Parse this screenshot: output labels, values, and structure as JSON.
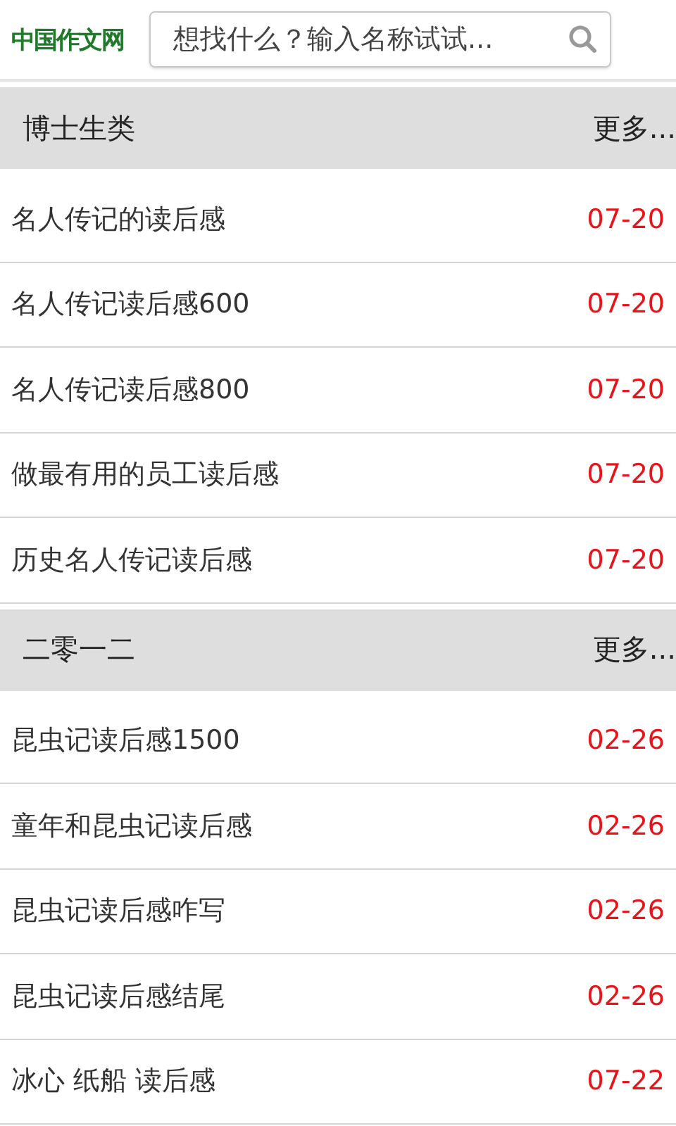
{
  "header": {
    "logo": "中国作文网",
    "search": {
      "placeholder": "想找什么？输入名称试试..."
    }
  },
  "sections": [
    {
      "title": "博士生类",
      "more": "更多...",
      "items": [
        {
          "title": "名人传记的读后感",
          "date": "07-20"
        },
        {
          "title": "名人传记读后感600",
          "date": "07-20"
        },
        {
          "title": "名人传记读后感800",
          "date": "07-20"
        },
        {
          "title": "做最有用的员工读后感",
          "date": "07-20"
        },
        {
          "title": "历史名人传记读后感",
          "date": "07-20"
        }
      ]
    },
    {
      "title": "二零一二",
      "more": "更多...",
      "items": [
        {
          "title": "昆虫记读后感1500",
          "date": "02-26"
        },
        {
          "title": "童年和昆虫记读后感",
          "date": "02-26"
        },
        {
          "title": "昆虫记读后感咋写",
          "date": "02-26"
        },
        {
          "title": "昆虫记读后感结尾",
          "date": "02-26"
        },
        {
          "title": "冰心 纸船 读后感",
          "date": "07-22"
        }
      ]
    }
  ]
}
